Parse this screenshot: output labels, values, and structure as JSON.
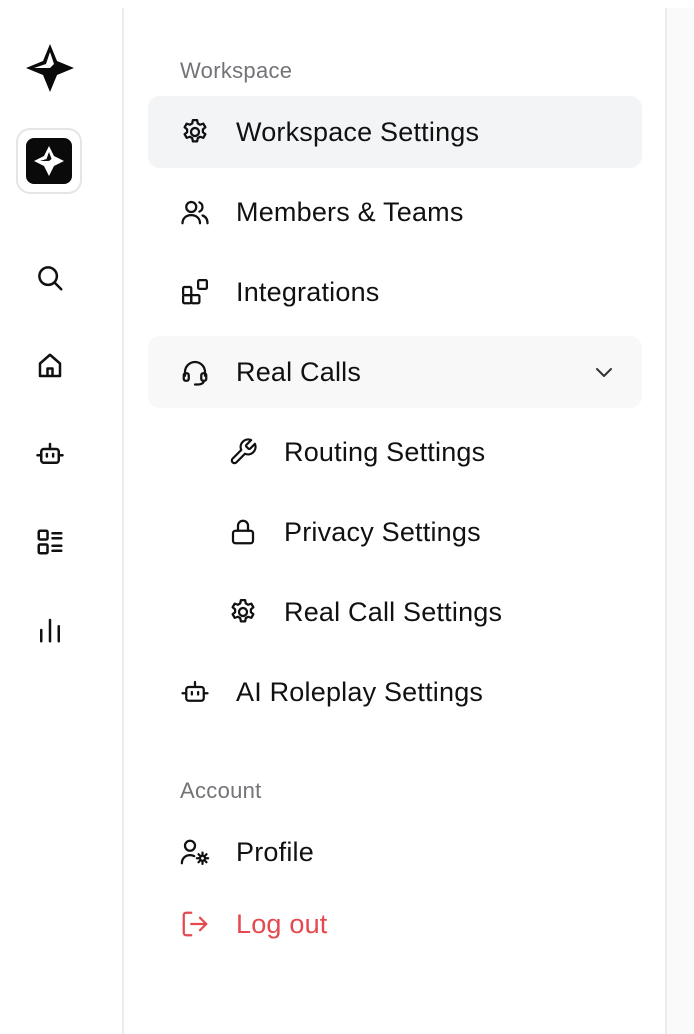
{
  "colors": {
    "text": "#111111",
    "muted": "#737378",
    "active_bg": "#f3f4f6",
    "danger": "#e5484d"
  },
  "rail": {
    "items": [
      {
        "icon": "logo-icon"
      },
      {
        "icon": "workspace-icon"
      },
      {
        "icon": "search-icon"
      },
      {
        "icon": "home-icon"
      },
      {
        "icon": "bot-icon"
      },
      {
        "icon": "list-icon"
      },
      {
        "icon": "bar-chart-icon"
      }
    ]
  },
  "nav": {
    "workspace_label": "Workspace",
    "account_label": "Account",
    "items": [
      {
        "label": "Workspace Settings",
        "icon": "gear-icon",
        "active": true
      },
      {
        "label": "Members & Teams",
        "icon": "users-icon"
      },
      {
        "label": "Integrations",
        "icon": "integrations-icon"
      },
      {
        "label": "Real Calls",
        "icon": "headset-icon",
        "expanded": true
      },
      {
        "label": "Routing Settings",
        "icon": "wrench-icon"
      },
      {
        "label": "Privacy Settings",
        "icon": "lock-icon"
      },
      {
        "label": "Real Call Settings",
        "icon": "gear-icon"
      },
      {
        "label": "AI Roleplay Settings",
        "icon": "bot-icon"
      },
      {
        "label": "Profile",
        "icon": "user-gear-icon"
      },
      {
        "label": "Log out",
        "icon": "logout-icon"
      }
    ]
  }
}
